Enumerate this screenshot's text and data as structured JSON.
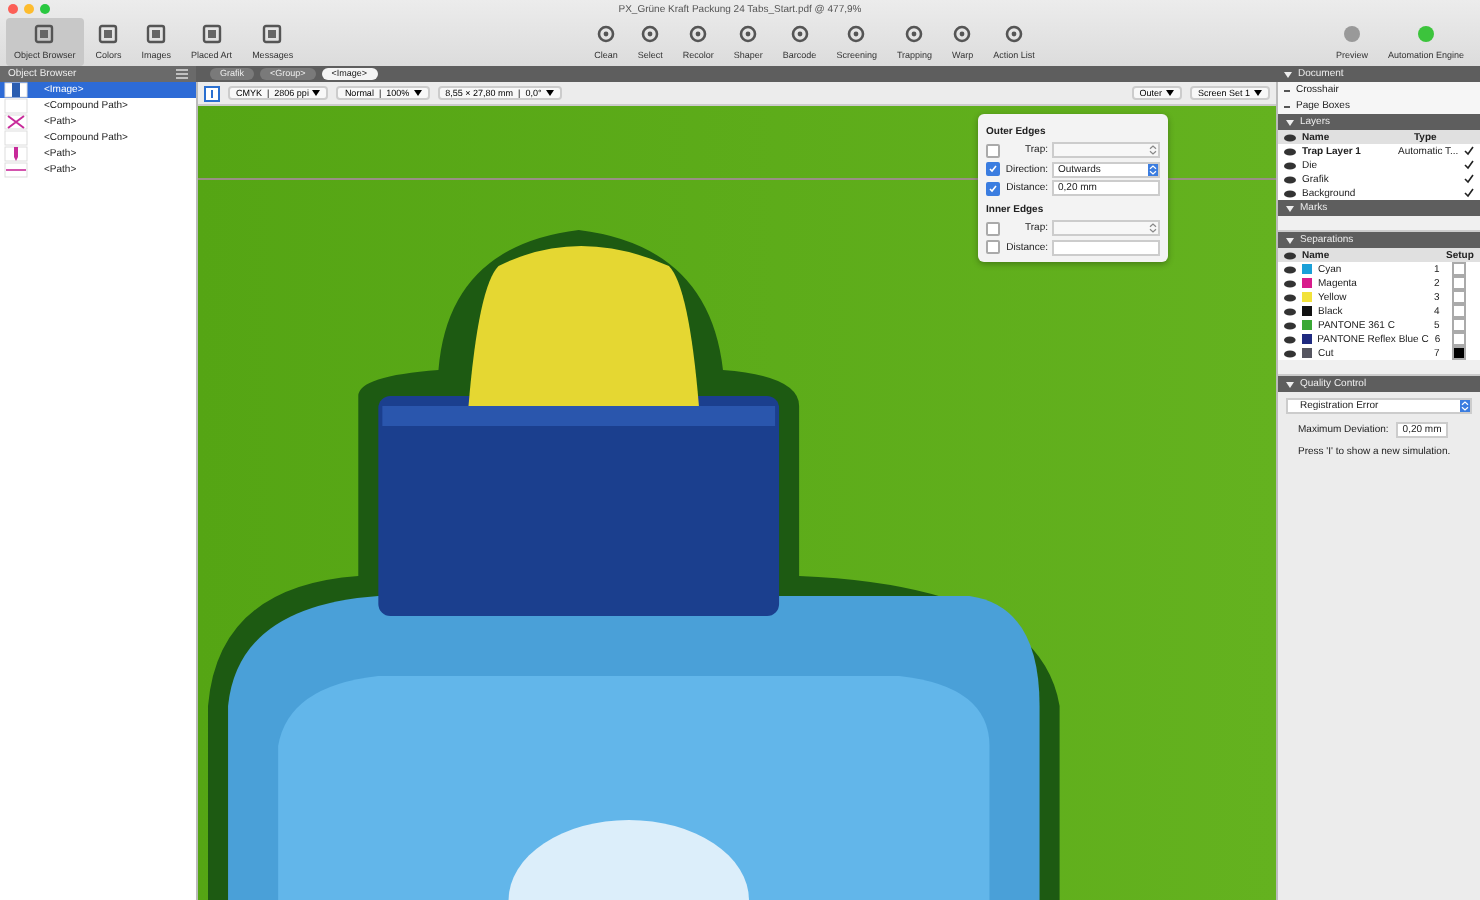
{
  "window": {
    "title": "PX_Grüne Kraft Packung 24 Tabs_Start.pdf @ 477,9%"
  },
  "toolbar": {
    "left": [
      {
        "label": "Object Browser",
        "selected": true
      },
      {
        "label": "Colors",
        "selected": false
      },
      {
        "label": "Images",
        "selected": false
      },
      {
        "label": "Placed Art",
        "selected": false
      },
      {
        "label": "Messages",
        "selected": false
      }
    ],
    "center": [
      {
        "label": "Clean"
      },
      {
        "label": "Select"
      },
      {
        "label": "Recolor"
      },
      {
        "label": "Shaper"
      },
      {
        "label": "Barcode"
      },
      {
        "label": "Screening"
      },
      {
        "label": "Trapping"
      },
      {
        "label": "Warp"
      },
      {
        "label": "Action List"
      }
    ],
    "right": [
      {
        "label": "Preview"
      },
      {
        "label": "Automation Engine"
      }
    ]
  },
  "object_browser": {
    "title": "Object Browser",
    "items": [
      {
        "label": "<Image>",
        "kind": "image",
        "selected": true
      },
      {
        "label": "<Compound Path>",
        "kind": "blank",
        "selected": false
      },
      {
        "label": "<Path>",
        "kind": "cross",
        "selected": false
      },
      {
        "label": "<Compound Path>",
        "kind": "blank",
        "selected": false
      },
      {
        "label": "<Path>",
        "kind": "pin",
        "selected": false
      },
      {
        "label": "<Path>",
        "kind": "line",
        "selected": false
      }
    ]
  },
  "breadcrumb": [
    {
      "label": "Grafik",
      "selected": false
    },
    {
      "label": "<Group>",
      "selected": false
    },
    {
      "label": "<Image>",
      "selected": true
    }
  ],
  "canvas_toolbar": {
    "color_info": "CMYK  |  2806 ppi",
    "blend": "Normal  |  100%",
    "size": "8,55 × 27,80 mm  |  0,0°",
    "trap_mode": "Outer",
    "screen_set": "Screen Set 1"
  },
  "trap_popover": {
    "sections": [
      {
        "title": "Outer Edges",
        "rows": [
          {
            "label": "Trap:",
            "checked": false,
            "kind": "select",
            "value": ""
          },
          {
            "label": "Direction:",
            "checked": true,
            "kind": "select",
            "value": "Outwards"
          },
          {
            "label": "Distance:",
            "checked": true,
            "kind": "field",
            "value": "0,20 mm"
          }
        ]
      },
      {
        "title": "Inner Edges",
        "rows": [
          {
            "label": "Trap:",
            "checked": false,
            "kind": "select",
            "value": ""
          },
          {
            "label": "Distance:",
            "checked": false,
            "kind": "field",
            "value": ""
          }
        ]
      }
    ]
  },
  "document": {
    "title": "Document",
    "items": [
      "Crosshair",
      "Page Boxes"
    ]
  },
  "layers": {
    "title": "Layers",
    "columns": [
      "Name",
      "Type"
    ],
    "rows": [
      {
        "name": "Trap Layer 1",
        "type": "Automatic T...",
        "bold": true
      },
      {
        "name": "Die",
        "type": "",
        "bold": false
      },
      {
        "name": "Grafik",
        "type": "",
        "bold": false
      },
      {
        "name": "Background",
        "type": "",
        "bold": false
      }
    ]
  },
  "marks": {
    "title": "Marks"
  },
  "separations": {
    "title": "Separations",
    "columns": [
      "Name",
      "Setup"
    ],
    "rows": [
      {
        "name": "Cyan",
        "number": "1",
        "color": "#1aa0d8",
        "checked": false
      },
      {
        "name": "Magenta",
        "number": "2",
        "color": "#d81b8c",
        "checked": false
      },
      {
        "name": "Yellow",
        "number": "3",
        "color": "#f2e23a",
        "checked": false
      },
      {
        "name": "Black",
        "number": "4",
        "color": "#111111",
        "checked": false
      },
      {
        "name": "PANTONE 361 C",
        "number": "5",
        "color": "#3aa835",
        "checked": false
      },
      {
        "name": "PANTONE Reflex Blue C",
        "number": "6",
        "color": "#1f2a80",
        "checked": false
      },
      {
        "name": "Cut",
        "number": "7",
        "color": "#555560",
        "checked": true
      }
    ]
  },
  "quality_control": {
    "title": "Quality Control",
    "check": "Registration Error",
    "deviation_label": "Maximum Deviation:",
    "deviation_value": "0,20 mm",
    "hint": "Press 'I' to show a new simulation."
  }
}
